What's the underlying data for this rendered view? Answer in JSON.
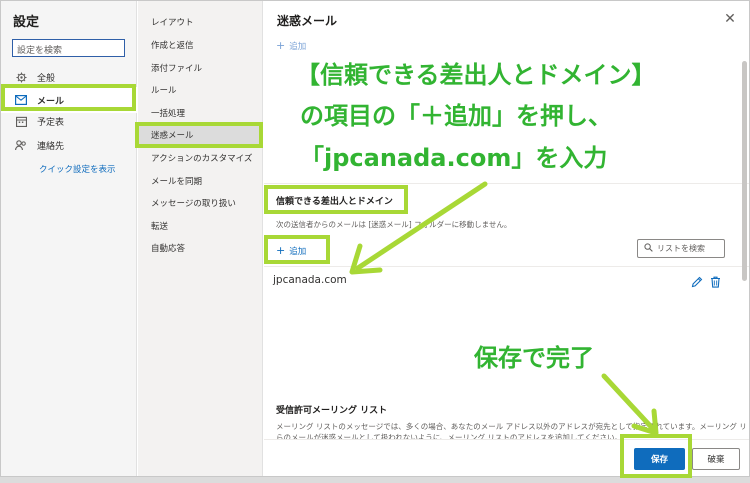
{
  "settings": {
    "title": "設定",
    "search_placeholder": "設定を検索"
  },
  "categories": [
    {
      "label": "全般",
      "icon": "gear-icon"
    },
    {
      "label": "メール",
      "icon": "mail-icon"
    },
    {
      "label": "予定表",
      "icon": "calendar-icon"
    },
    {
      "label": "連絡先",
      "icon": "people-icon"
    }
  ],
  "quick_settings_link": "クイック設定を表示",
  "subcategories": [
    "レイアウト",
    "作成と返信",
    "添付ファイル",
    "ルール",
    "一括処理",
    "迷惑メール",
    "アクションのカスタマイズ",
    "メールを同期",
    "メッセージの取り扱い",
    "転送",
    "自動応答"
  ],
  "main": {
    "title": "迷惑メール",
    "top_add": "追加",
    "trusted_title": "信頼できる差出人とドメイン",
    "trusted_desc": "次の送信者からのメールは [迷惑メール] フォルダーに移動しません。",
    "trusted_add": "追加",
    "list_search": "リストを検索",
    "domain": "jpcanada.com",
    "safe_title": "受信許可メーリング リスト",
    "safe_desc_1": "メーリング リストのメッセージでは、多くの場合、あなたのメール アドレス以外のアドレスが宛先として指定されています。メーリング リストか",
    "safe_desc_2": "らのメールが迷惑メールとして扱われないように、メーリング リストのアドレスを追加してください。"
  },
  "footer": {
    "save": "保存",
    "discard": "破棄"
  },
  "annotations": {
    "line1": "【信頼できる差出人とドメイン】",
    "line2": "の項目の「＋追加」を押し、",
    "line3": "「jpcanada.com」を入力",
    "save": "保存で完了"
  },
  "colors": {
    "accent": "#0f6cbd",
    "annotation_text": "#32b432",
    "highlight": "#a8d836"
  }
}
